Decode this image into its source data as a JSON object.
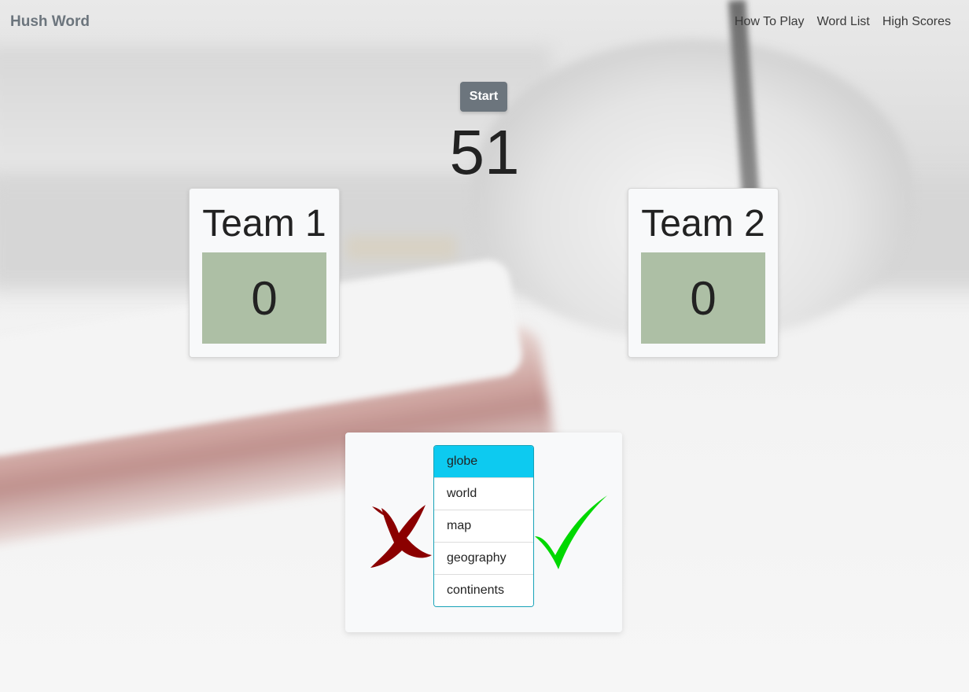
{
  "navbar": {
    "brand": "Hush Word",
    "links": [
      "How To Play",
      "Word List",
      "High Scores"
    ]
  },
  "game": {
    "start_label": "Start",
    "timer": "51"
  },
  "teams": [
    {
      "name": "Team 1",
      "score": "0"
    },
    {
      "name": "Team 2",
      "score": "0"
    }
  ],
  "words": {
    "target": "globe",
    "hush_words": [
      "world",
      "map",
      "geography",
      "continents"
    ]
  },
  "icons": {
    "wrong": "red-x-icon",
    "correct": "green-checkmark-icon"
  },
  "colors": {
    "score_box": "#adbfa5",
    "active_word": "#0dcaf0",
    "list_border": "#17a2b8",
    "wrong_icon": "#8b0000",
    "correct_icon": "#00d800",
    "start_button": "#6c757d"
  }
}
